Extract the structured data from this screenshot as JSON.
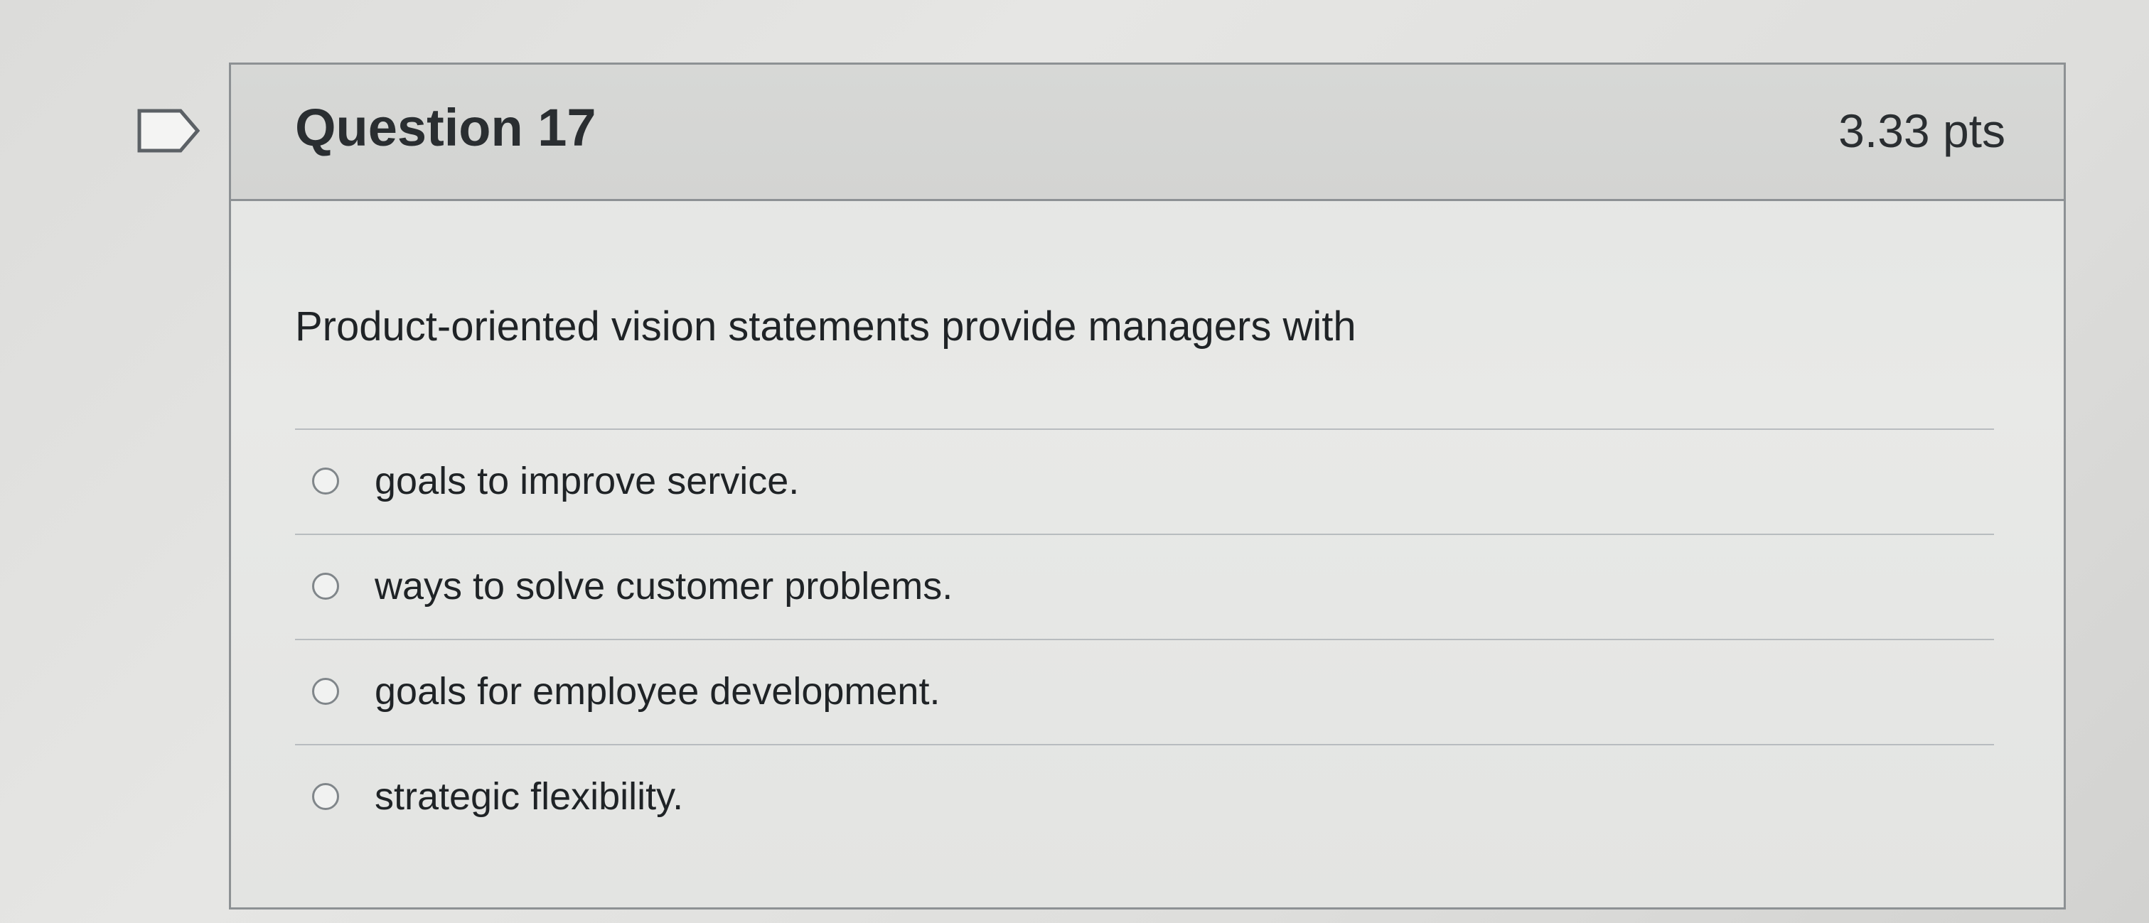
{
  "question": {
    "title": "Question 17",
    "points": "3.33 pts",
    "text": "Product-oriented vision statements provide managers with",
    "flag_icon": "flag-outline-icon",
    "answers": [
      {
        "label": "goals to improve service.",
        "selected": false
      },
      {
        "label": "ways to solve customer problems.",
        "selected": false
      },
      {
        "label": "goals for employee development.",
        "selected": false
      },
      {
        "label": "strategic flexibility.",
        "selected": false
      }
    ]
  },
  "colors": {
    "border": "#8d9194",
    "header_bg": "#d7d8d6",
    "text": "#1f2326"
  }
}
